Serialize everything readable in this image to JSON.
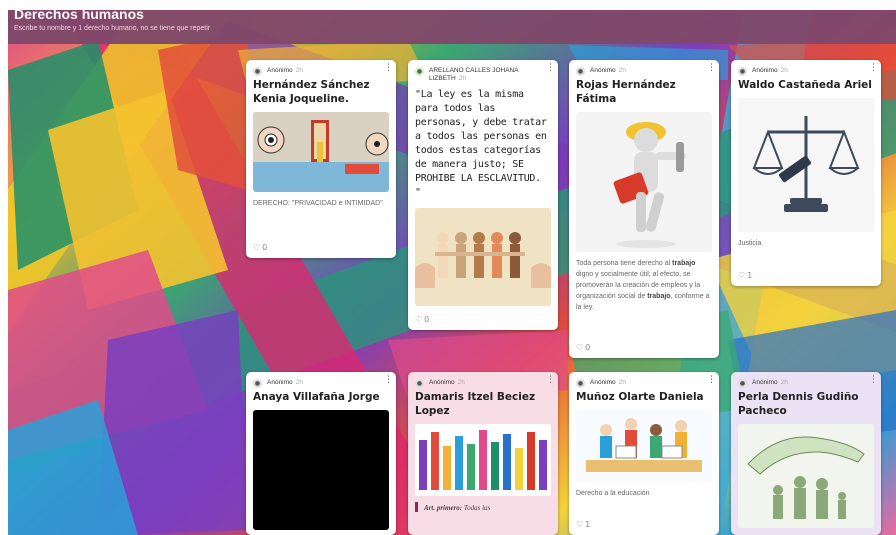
{
  "header": {
    "title": "Derechos humanos",
    "subtitle": "Escribe tu nombre y 1 derecho humano, no se tiene que repetir"
  },
  "posts": [
    {
      "author": "Anónimo",
      "time": "2h",
      "title": "Hernández Sánchez Kenia Joqueline.",
      "description": "DERECHO: \"PRIVACIDAD e INTIMIDAD\"",
      "likes": "0",
      "image": "privacy-illustration"
    },
    {
      "author": "ARELLANO CALLES JOHANA LIZBETH",
      "time": "2h",
      "quote": "\"La ley es la misma para todos las personas, y debe tratar a todos las personas en todos estas categorías de manera justo; SE PROHIBE LA ESCLAVITUD. \"",
      "likes": "0",
      "image": "paper-people-chain"
    },
    {
      "author": "Anónimo",
      "time": "2h",
      "title": "Rojas Hernández Fátima",
      "description_parts": [
        "Toda persona tiene derecho al ",
        "trabajo",
        " digno y socialmente útil; al efecto, se promoverán la creación de empleos y la organización social de ",
        "trabajo",
        ", conforme a la ley."
      ],
      "likes": "0",
      "image": "worker-figure"
    },
    {
      "author": "Anónimo",
      "time": "2h",
      "title": "Waldo Castañeda Ariel",
      "description": "Justicia",
      "likes": "1",
      "image": "scales-of-justice"
    },
    {
      "author": "Anónimo",
      "time": "2h",
      "title": "Anaya Villafaña Jorge",
      "image": "black-image"
    },
    {
      "author": "Anónimo",
      "time": "2h",
      "title": "Damaris Itzel Beciez Lopez",
      "quote_label": "Art. primero:",
      "quote_text": "Todas las",
      "image": "raised-hands"
    },
    {
      "author": "Anónimo",
      "time": "2h",
      "title": "Muñoz Olarte Daniela",
      "description": "Derecho a la educación",
      "likes": "1",
      "image": "children-reading"
    },
    {
      "author": "Anónimo",
      "time": "2h",
      "title": "Perla Dennis Gudiño Pacheco",
      "image": "family-protection"
    }
  ],
  "icons": {
    "avatar": "user-icon",
    "menu": "kebab-menu-icon",
    "like": "heart-icon"
  },
  "colors": {
    "header": "#80486a",
    "card": "#ffffff",
    "pink_card": "#f8dde6",
    "lavender_card": "#ebe3f5"
  }
}
